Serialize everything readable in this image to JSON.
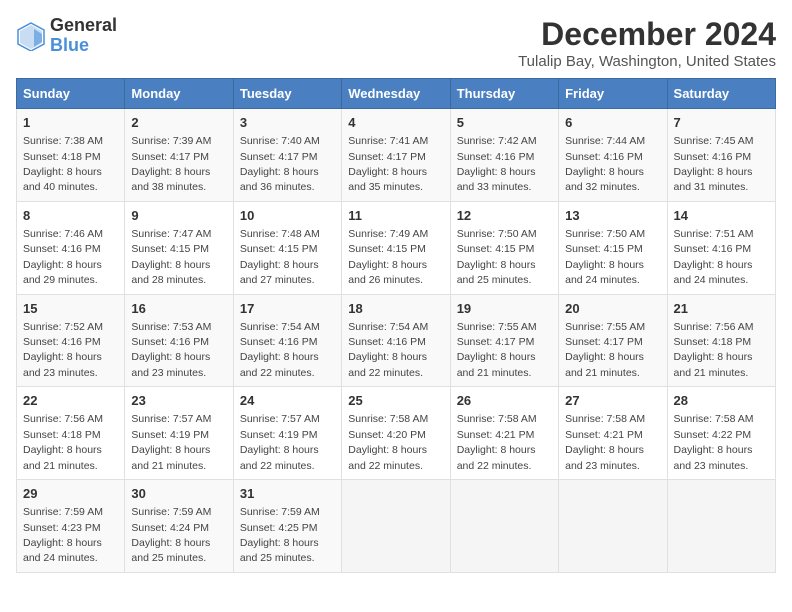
{
  "logo": {
    "general": "General",
    "blue": "Blue"
  },
  "title": "December 2024",
  "subtitle": "Tulalip Bay, Washington, United States",
  "days": [
    "Sunday",
    "Monday",
    "Tuesday",
    "Wednesday",
    "Thursday",
    "Friday",
    "Saturday"
  ],
  "weeks": [
    [
      {
        "date": "1",
        "sunrise": "7:38 AM",
        "sunset": "4:18 PM",
        "daylight": "8 hours and 40 minutes."
      },
      {
        "date": "2",
        "sunrise": "7:39 AM",
        "sunset": "4:17 PM",
        "daylight": "8 hours and 38 minutes."
      },
      {
        "date": "3",
        "sunrise": "7:40 AM",
        "sunset": "4:17 PM",
        "daylight": "8 hours and 36 minutes."
      },
      {
        "date": "4",
        "sunrise": "7:41 AM",
        "sunset": "4:17 PM",
        "daylight": "8 hours and 35 minutes."
      },
      {
        "date": "5",
        "sunrise": "7:42 AM",
        "sunset": "4:16 PM",
        "daylight": "8 hours and 33 minutes."
      },
      {
        "date": "6",
        "sunrise": "7:44 AM",
        "sunset": "4:16 PM",
        "daylight": "8 hours and 32 minutes."
      },
      {
        "date": "7",
        "sunrise": "7:45 AM",
        "sunset": "4:16 PM",
        "daylight": "8 hours and 31 minutes."
      }
    ],
    [
      {
        "date": "8",
        "sunrise": "7:46 AM",
        "sunset": "4:16 PM",
        "daylight": "8 hours and 29 minutes."
      },
      {
        "date": "9",
        "sunrise": "7:47 AM",
        "sunset": "4:15 PM",
        "daylight": "8 hours and 28 minutes."
      },
      {
        "date": "10",
        "sunrise": "7:48 AM",
        "sunset": "4:15 PM",
        "daylight": "8 hours and 27 minutes."
      },
      {
        "date": "11",
        "sunrise": "7:49 AM",
        "sunset": "4:15 PM",
        "daylight": "8 hours and 26 minutes."
      },
      {
        "date": "12",
        "sunrise": "7:50 AM",
        "sunset": "4:15 PM",
        "daylight": "8 hours and 25 minutes."
      },
      {
        "date": "13",
        "sunrise": "7:50 AM",
        "sunset": "4:15 PM",
        "daylight": "8 hours and 24 minutes."
      },
      {
        "date": "14",
        "sunrise": "7:51 AM",
        "sunset": "4:16 PM",
        "daylight": "8 hours and 24 minutes."
      }
    ],
    [
      {
        "date": "15",
        "sunrise": "7:52 AM",
        "sunset": "4:16 PM",
        "daylight": "8 hours and 23 minutes."
      },
      {
        "date": "16",
        "sunrise": "7:53 AM",
        "sunset": "4:16 PM",
        "daylight": "8 hours and 23 minutes."
      },
      {
        "date": "17",
        "sunrise": "7:54 AM",
        "sunset": "4:16 PM",
        "daylight": "8 hours and 22 minutes."
      },
      {
        "date": "18",
        "sunrise": "7:54 AM",
        "sunset": "4:16 PM",
        "daylight": "8 hours and 22 minutes."
      },
      {
        "date": "19",
        "sunrise": "7:55 AM",
        "sunset": "4:17 PM",
        "daylight": "8 hours and 21 minutes."
      },
      {
        "date": "20",
        "sunrise": "7:55 AM",
        "sunset": "4:17 PM",
        "daylight": "8 hours and 21 minutes."
      },
      {
        "date": "21",
        "sunrise": "7:56 AM",
        "sunset": "4:18 PM",
        "daylight": "8 hours and 21 minutes."
      }
    ],
    [
      {
        "date": "22",
        "sunrise": "7:56 AM",
        "sunset": "4:18 PM",
        "daylight": "8 hours and 21 minutes."
      },
      {
        "date": "23",
        "sunrise": "7:57 AM",
        "sunset": "4:19 PM",
        "daylight": "8 hours and 21 minutes."
      },
      {
        "date": "24",
        "sunrise": "7:57 AM",
        "sunset": "4:19 PM",
        "daylight": "8 hours and 22 minutes."
      },
      {
        "date": "25",
        "sunrise": "7:58 AM",
        "sunset": "4:20 PM",
        "daylight": "8 hours and 22 minutes."
      },
      {
        "date": "26",
        "sunrise": "7:58 AM",
        "sunset": "4:21 PM",
        "daylight": "8 hours and 22 minutes."
      },
      {
        "date": "27",
        "sunrise": "7:58 AM",
        "sunset": "4:21 PM",
        "daylight": "8 hours and 23 minutes."
      },
      {
        "date": "28",
        "sunrise": "7:58 AM",
        "sunset": "4:22 PM",
        "daylight": "8 hours and 23 minutes."
      }
    ],
    [
      {
        "date": "29",
        "sunrise": "7:59 AM",
        "sunset": "4:23 PM",
        "daylight": "8 hours and 24 minutes."
      },
      {
        "date": "30",
        "sunrise": "7:59 AM",
        "sunset": "4:24 PM",
        "daylight": "8 hours and 25 minutes."
      },
      {
        "date": "31",
        "sunrise": "7:59 AM",
        "sunset": "4:25 PM",
        "daylight": "8 hours and 25 minutes."
      },
      null,
      null,
      null,
      null
    ]
  ],
  "labels": {
    "sunrise": "Sunrise:",
    "sunset": "Sunset:",
    "daylight": "Daylight:"
  }
}
